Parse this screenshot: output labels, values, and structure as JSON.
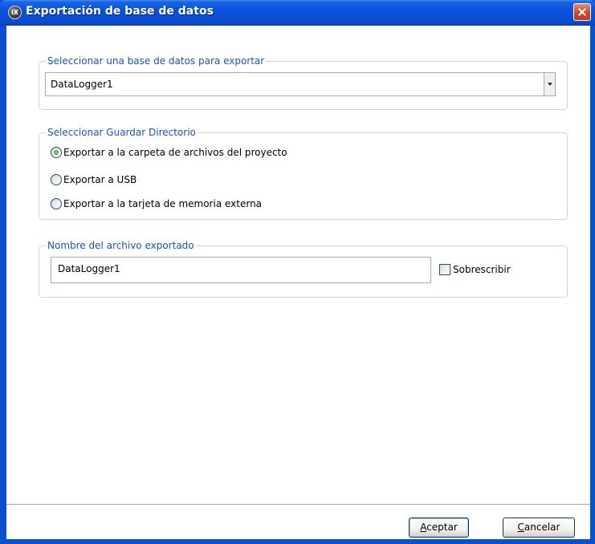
{
  "window": {
    "title": "Exportación de base de datos",
    "app_icon_text": "iX"
  },
  "database_group": {
    "legend": "Seleccionar una base de datos para exportar",
    "selected_value": "DataLogger1"
  },
  "directory_group": {
    "legend": "Seleccionar Guardar Directorio",
    "options": [
      {
        "label": "Exportar a la carpeta de archivos del proyecto",
        "checked": true
      },
      {
        "label": "Exportar a USB",
        "checked": false
      },
      {
        "label": "Exportar a la tarjeta de memoria externa",
        "checked": false
      }
    ]
  },
  "filename_group": {
    "legend": "Nombre del archivo exportado",
    "value": "DataLogger1",
    "overwrite_label": "Sobrescribir",
    "overwrite_checked": false
  },
  "buttons": {
    "ok_first": "A",
    "ok_rest": "ceptar",
    "cancel_first": "C",
    "cancel_rest": "ancelar"
  },
  "colors": {
    "titlebar": "#0a4bd0",
    "legend": "#1a53c9",
    "close": "#d2451f"
  }
}
